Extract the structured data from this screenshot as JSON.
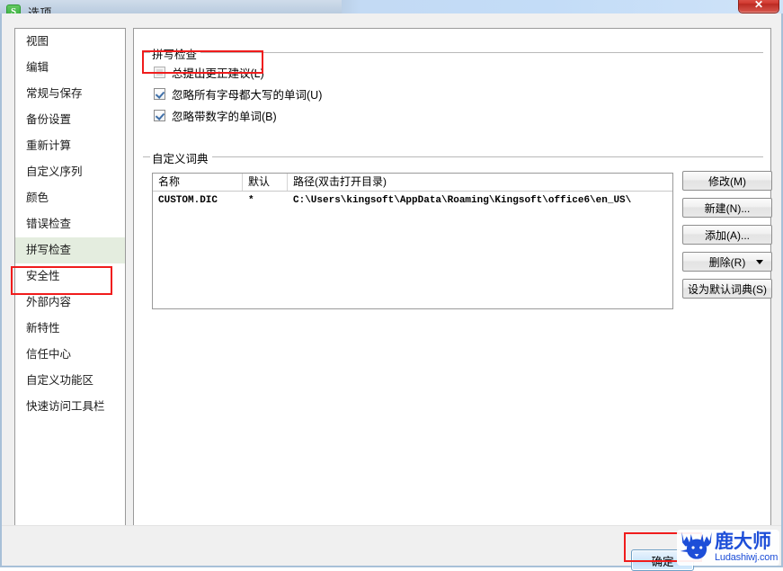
{
  "window": {
    "title": "选项",
    "app_icon": "S",
    "close_label": "✕",
    "accent_green": "#2faa38",
    "accent_blue": "#1d4ed8",
    "annotation_red": "#f01c1c"
  },
  "sidebar": {
    "items": [
      {
        "label": "视图",
        "selected": false
      },
      {
        "label": "编辑",
        "selected": false
      },
      {
        "label": "常规与保存",
        "selected": false
      },
      {
        "label": "备份设置",
        "selected": false
      },
      {
        "label": "重新计算",
        "selected": false
      },
      {
        "label": "自定义序列",
        "selected": false
      },
      {
        "label": "颜色",
        "selected": false
      },
      {
        "label": "错误检查",
        "selected": false
      },
      {
        "label": "拼写检查",
        "selected": true
      },
      {
        "label": "安全性",
        "selected": false
      },
      {
        "label": "外部内容",
        "selected": false
      },
      {
        "label": "新特性",
        "selected": false
      },
      {
        "label": "信任中心",
        "selected": false
      },
      {
        "label": "自定义功能区",
        "selected": false
      },
      {
        "label": "快速访问工具栏",
        "selected": false
      }
    ]
  },
  "spell_group": {
    "legend": "拼写检查",
    "options": [
      {
        "label": "总提出更正建议(L)",
        "checked": false,
        "disabled": true
      },
      {
        "label": "忽略所有字母都大写的单词(U)",
        "checked": true,
        "disabled": false
      },
      {
        "label": "忽略带数字的单词(B)",
        "checked": true,
        "disabled": false
      }
    ]
  },
  "dict_group": {
    "legend": "自定义词典",
    "columns": [
      "名称",
      "默认",
      "路径(双击打开目录)"
    ],
    "rows": [
      [
        "CUSTOM.DIC",
        "*",
        "C:\\Users\\kingsoft\\AppData\\Roaming\\Kingsoft\\office6\\en_US\\"
      ]
    ],
    "buttons": [
      {
        "label": "修改(M)",
        "has_caret": false
      },
      {
        "label": "新建(N)...",
        "has_caret": false
      },
      {
        "label": "添加(A)...",
        "has_caret": false
      },
      {
        "label": "删除(R)",
        "has_caret": true
      },
      {
        "label": "设为默认词典(S)",
        "has_caret": false
      }
    ]
  },
  "footer": {
    "ok_label": "确定"
  },
  "watermark": {
    "cn": "鹿大师",
    "en": "Ludashiwj.com"
  }
}
